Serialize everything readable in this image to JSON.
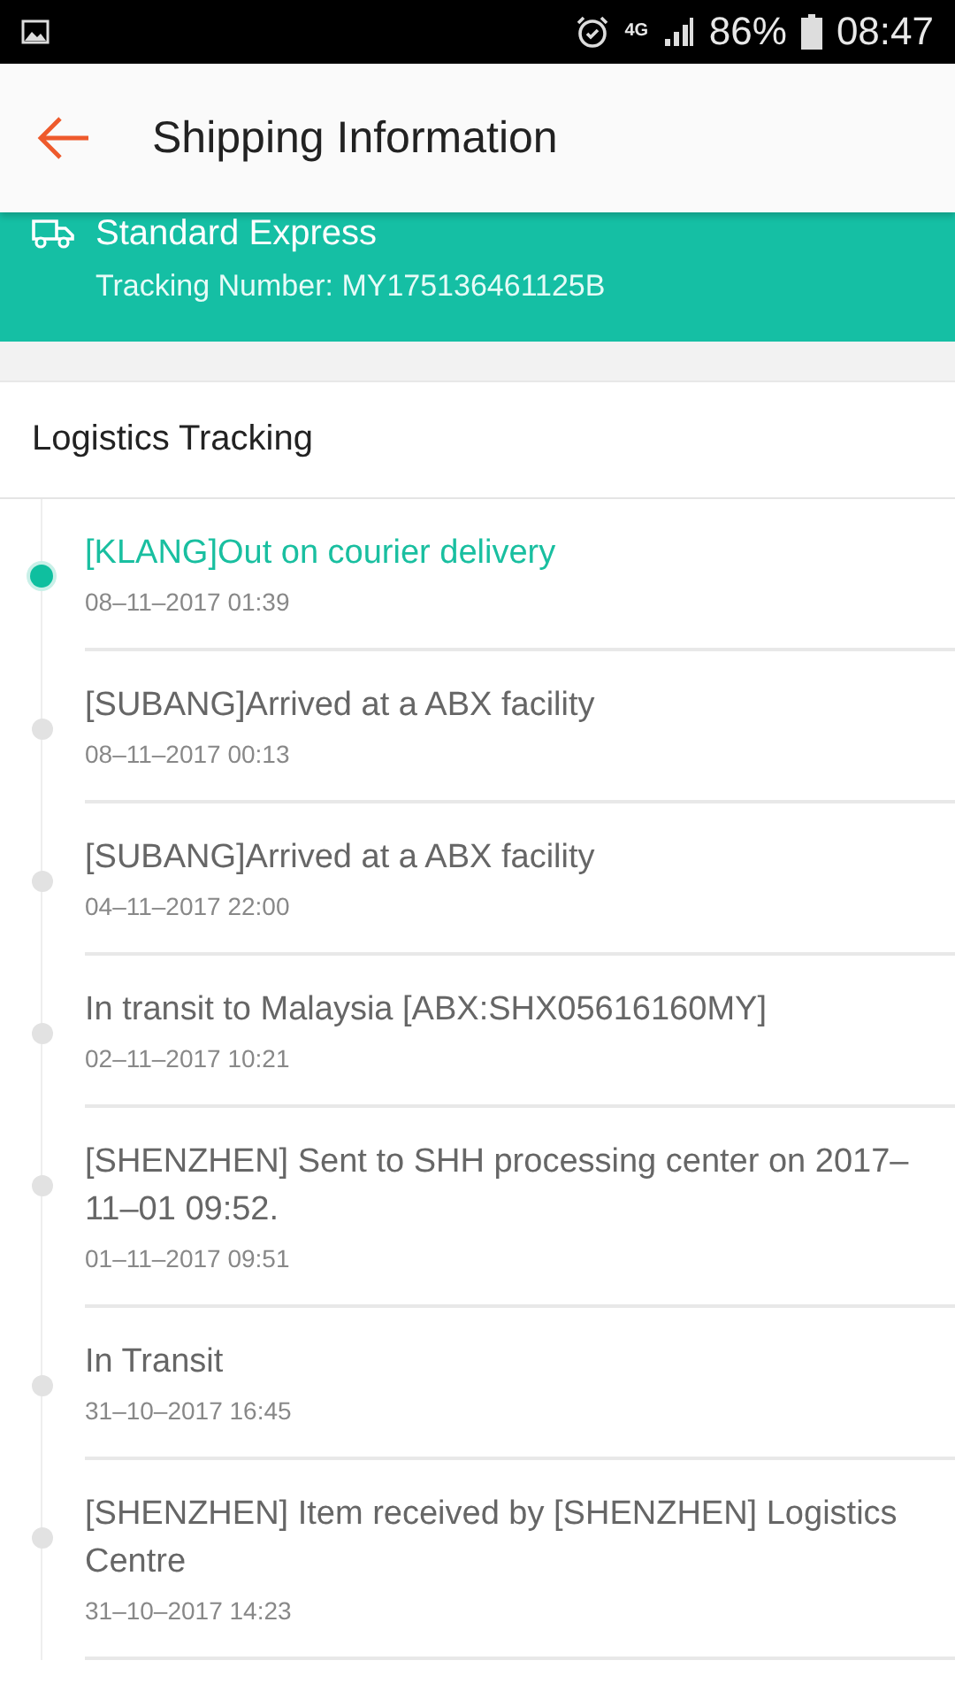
{
  "status_bar": {
    "network": "4G",
    "battery": "86%",
    "time": "08:47"
  },
  "header": {
    "title": "Shipping Information"
  },
  "shipment": {
    "service": "Standard Express",
    "tracking_number": "Tracking Number: MY175136461125B"
  },
  "section": {
    "title": "Logistics Tracking"
  },
  "events": [
    {
      "status": "[KLANG]Out on courier delivery",
      "time": "08–11–2017 01:39",
      "current": true
    },
    {
      "status": "[SUBANG]Arrived at a ABX facility",
      "time": "08–11–2017 00:13",
      "current": false
    },
    {
      "status": "[SUBANG]Arrived at a ABX facility",
      "time": "04–11–2017 22:00",
      "current": false
    },
    {
      "status": "In transit to Malaysia [ABX:SHX05616160MY]",
      "time": "02–11–2017 10:21",
      "current": false
    },
    {
      "status": "[SHENZHEN] Sent to SHH processing center on 2017–11–01 09:52.",
      "time": "01–11–2017 09:51",
      "current": false
    },
    {
      "status": "In Transit",
      "time": "31–10–2017 16:45",
      "current": false
    },
    {
      "status": "[SHENZHEN] Item received by [SHENZHEN] Logistics Centre",
      "time": "31–10–2017 14:23",
      "current": false
    }
  ]
}
